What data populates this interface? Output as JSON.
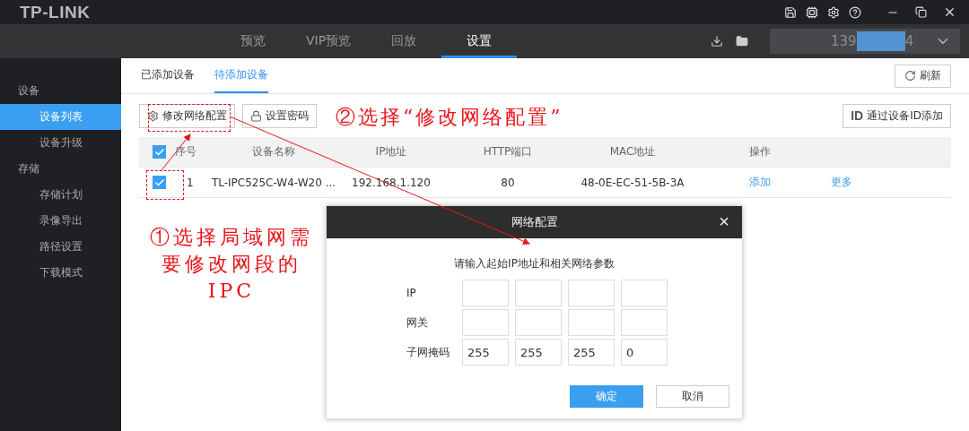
{
  "title_bar": {
    "logo": "TP-LINK"
  },
  "nav": {
    "tabs": [
      {
        "label": "预览",
        "selected": false
      },
      {
        "label": "VIP预览",
        "selected": false
      },
      {
        "label": "回放",
        "selected": false
      },
      {
        "label": "设置",
        "selected": true
      }
    ],
    "account": {
      "prefix": "139",
      "suffix": "4",
      "masked": true
    }
  },
  "sidebar": {
    "groups": [
      {
        "label": "设备",
        "children": [
          {
            "label": "设备列表",
            "selected": true
          },
          {
            "label": "设备升级",
            "selected": false
          }
        ]
      },
      {
        "label": "存储",
        "children": [
          {
            "label": "存储计划",
            "selected": false
          },
          {
            "label": "录像导出",
            "selected": false
          },
          {
            "label": "路径设置",
            "selected": false
          },
          {
            "label": "下载模式",
            "selected": false
          }
        ]
      }
    ]
  },
  "sub_tabs": [
    {
      "label": "已添加设备",
      "selected": false
    },
    {
      "label": "待添加设备",
      "selected": true
    }
  ],
  "refresh_button": "刷新",
  "toolbar": {
    "buttons": [
      {
        "label": "修改网络配置",
        "kind": "network"
      },
      {
        "label": "设置密码",
        "kind": "password"
      }
    ],
    "add_by_id": {
      "badge": "ID",
      "label": "通过设备ID添加"
    }
  },
  "table": {
    "header_checked": true,
    "columns": [
      "序号",
      "设备名称",
      "IP地址",
      "HTTP端口",
      "MAC地址",
      "操作"
    ],
    "rows": [
      {
        "checked": true,
        "cells": [
          "1",
          "TL-IPC525C-W4-W20 ...",
          "192.168.1.120",
          "80",
          "48-0E-EC-51-5B-3A"
        ],
        "actions": [
          "添加",
          "更多"
        ]
      }
    ]
  },
  "dialog": {
    "title": "网络配置",
    "close": "×",
    "prompt": "请输入起始IP地址和相关网络参数",
    "fields": [
      {
        "label": "IP"
      },
      {
        "label": "网关"
      },
      {
        "label": "子网掩码",
        "values": [
          "255",
          "255",
          "255",
          "0"
        ]
      }
    ],
    "buttons": [
      {
        "label": "确定",
        "kind": "primary"
      },
      {
        "label": "取消",
        "kind": "secondary"
      }
    ]
  },
  "annotations": [
    {
      "text": "①选择局域网需要修改网段的IPC"
    },
    {
      "text": "②选择“修改网络配置”"
    }
  ]
}
